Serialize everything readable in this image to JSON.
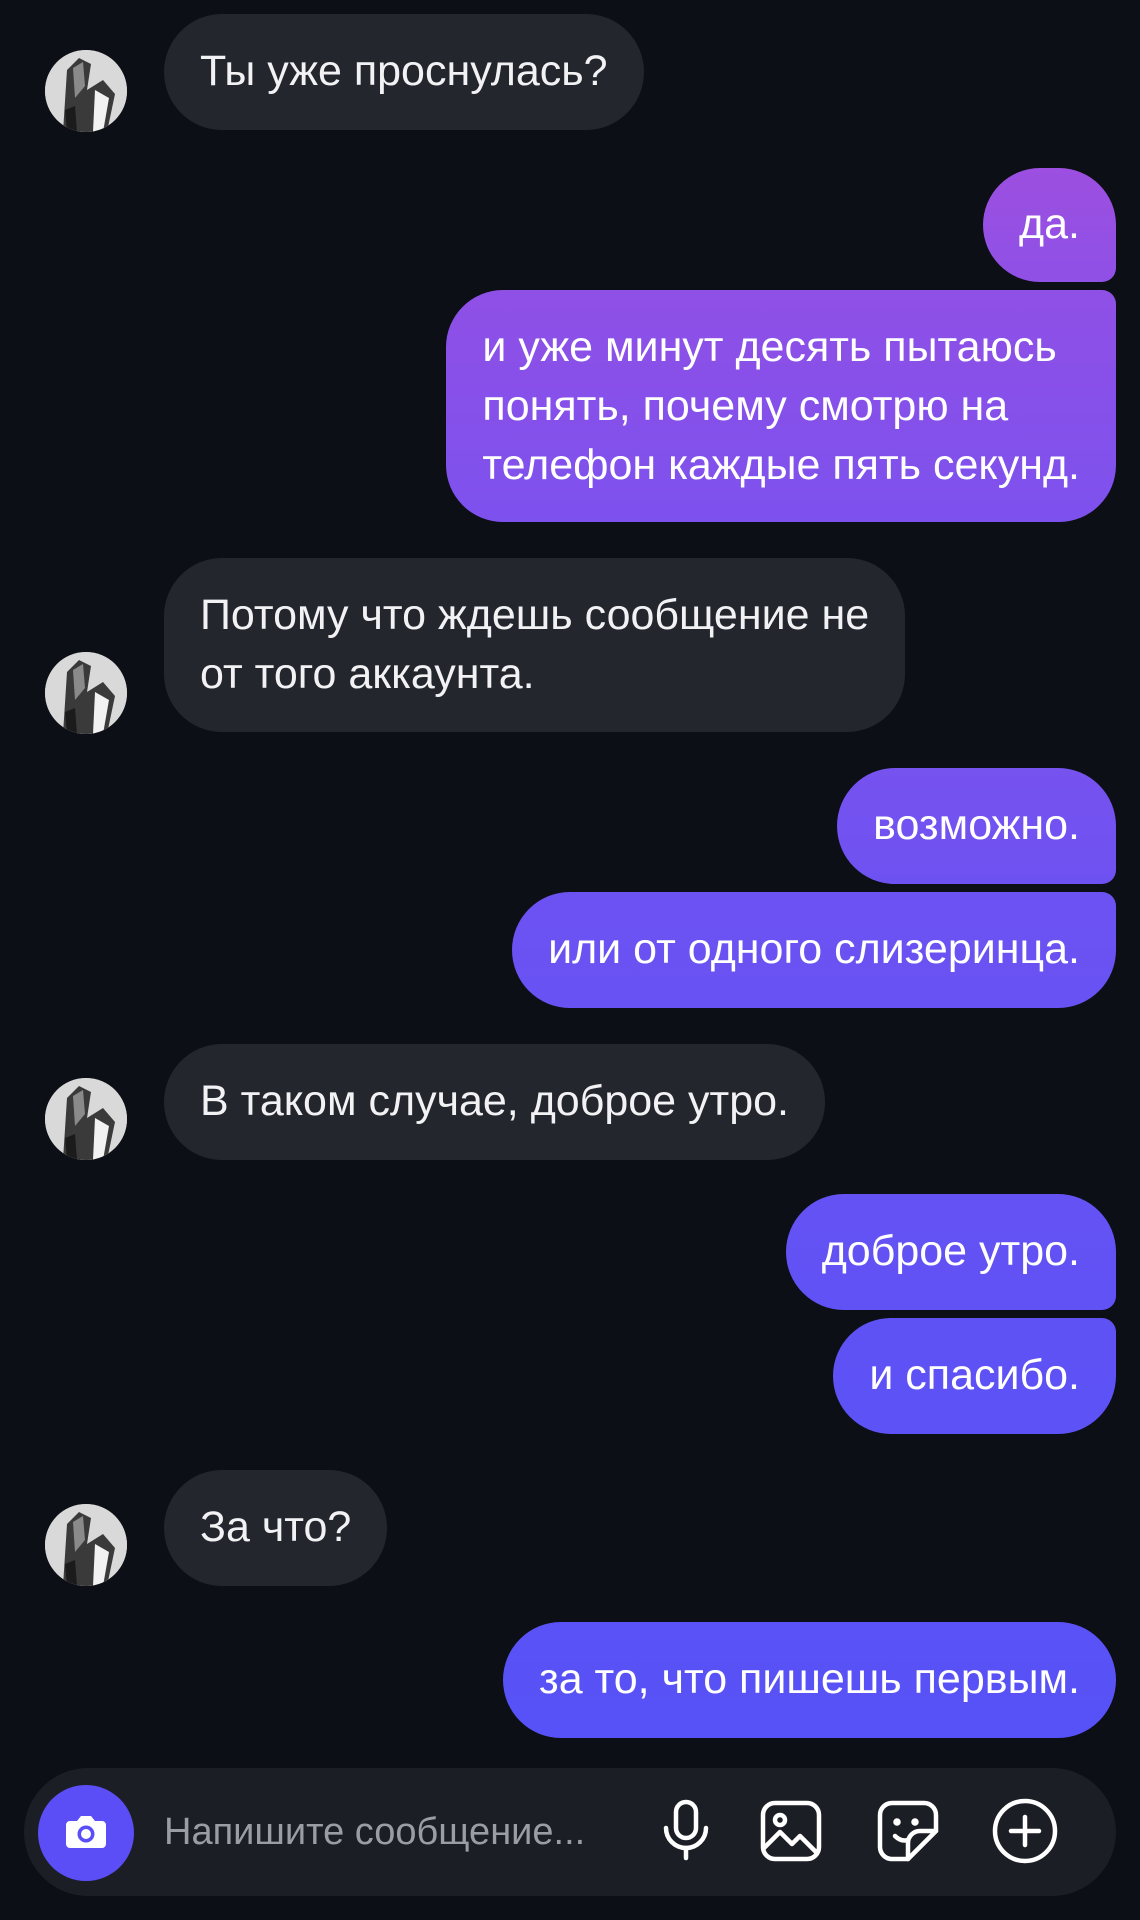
{
  "colors": {
    "background": "#0d0f16",
    "received_bubble": "#24262e",
    "sent_gradient_top": "#9b4fe0",
    "sent_gradient_bottom": "#5a52f5",
    "accent": "#5c4ef6"
  },
  "messages": [
    {
      "direction": "received",
      "lines": [
        "Ты уже проснулась?"
      ]
    },
    {
      "direction": "sent",
      "lines": [
        "да."
      ]
    },
    {
      "direction": "sent",
      "lines": [
        "и уже минут десять пытаюсь",
        "понять, почему смотрю на",
        "телефон каждые пять секунд."
      ]
    },
    {
      "direction": "received",
      "lines": [
        "Потому что ждешь сообщение не",
        "от того аккаунта."
      ]
    },
    {
      "direction": "sent",
      "lines": [
        "возможно."
      ]
    },
    {
      "direction": "sent",
      "lines": [
        "или от одного слизеринца."
      ]
    },
    {
      "direction": "received",
      "lines": [
        "В таком случае, доброе утро."
      ]
    },
    {
      "direction": "sent",
      "lines": [
        "доброе утро."
      ]
    },
    {
      "direction": "sent",
      "lines": [
        "и спасибо."
      ]
    },
    {
      "direction": "received",
      "lines": [
        "За что?"
      ]
    },
    {
      "direction": "sent",
      "lines": [
        "за то, что пишешь первым."
      ]
    }
  ],
  "composer": {
    "placeholder": "Напишите сообщение...",
    "icons": [
      "camera-icon",
      "microphone-icon",
      "image-icon",
      "sticker-icon",
      "plus-icon"
    ]
  }
}
